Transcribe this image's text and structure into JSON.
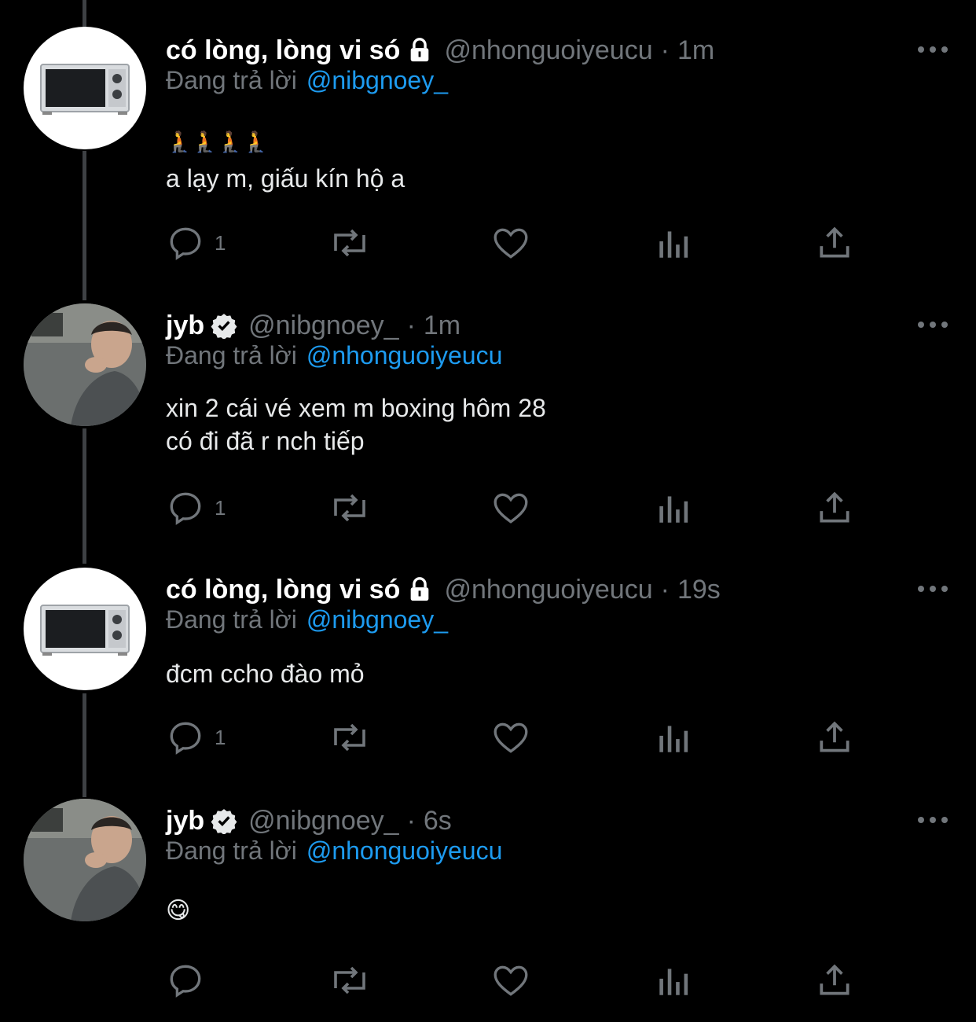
{
  "tweets": [
    {
      "display_name": "có lòng, lòng vi só",
      "badge_icon": "lock-icon",
      "handle": "@nhonguoiyeucu",
      "separator": "·",
      "time": "1m",
      "reply_prefix": "Đang trả lời",
      "reply_to": "@nibgnoey_",
      "emoji_line": "🧎🧎🧎🧎",
      "text_lines": [
        "a lạy m, giấu kín hộ a"
      ],
      "reply_count": "1",
      "avatar": "microwave-avatar"
    },
    {
      "display_name": "jyb",
      "badge_icon": "verified-icon",
      "handle": "@nibgnoey_",
      "separator": "·",
      "time": "1m",
      "reply_prefix": "Đang trả lời",
      "reply_to": "@nhonguoiyeucu",
      "text_lines": [
        "xin 2 cái vé xem m boxing hôm 28",
        "có đi đã r nch tiếp"
      ],
      "reply_count": "1",
      "avatar": "user-photo-avatar"
    },
    {
      "display_name": "có lòng, lòng vi só",
      "badge_icon": "lock-icon",
      "handle": "@nhonguoiyeucu",
      "separator": "·",
      "time": "19s",
      "reply_prefix": "Đang trả lời",
      "reply_to": "@nibgnoey_",
      "text_lines": [
        "đcm ccho đào mỏ"
      ],
      "reply_count": "1",
      "avatar": "microwave-avatar"
    },
    {
      "display_name": "jyb",
      "badge_icon": "verified-icon",
      "handle": "@nibgnoey_",
      "separator": "·",
      "time": "6s",
      "reply_prefix": "Đang trả lời",
      "reply_to": "@nhonguoiyeucu",
      "text_lines": [
        "😋"
      ],
      "reply_count": "",
      "avatar": "user-photo-avatar"
    }
  ],
  "colors": {
    "background": "#000000",
    "text": "#e7e9ea",
    "muted": "#71767b",
    "link": "#1d9bf0",
    "thread_line": "#3e4144"
  }
}
